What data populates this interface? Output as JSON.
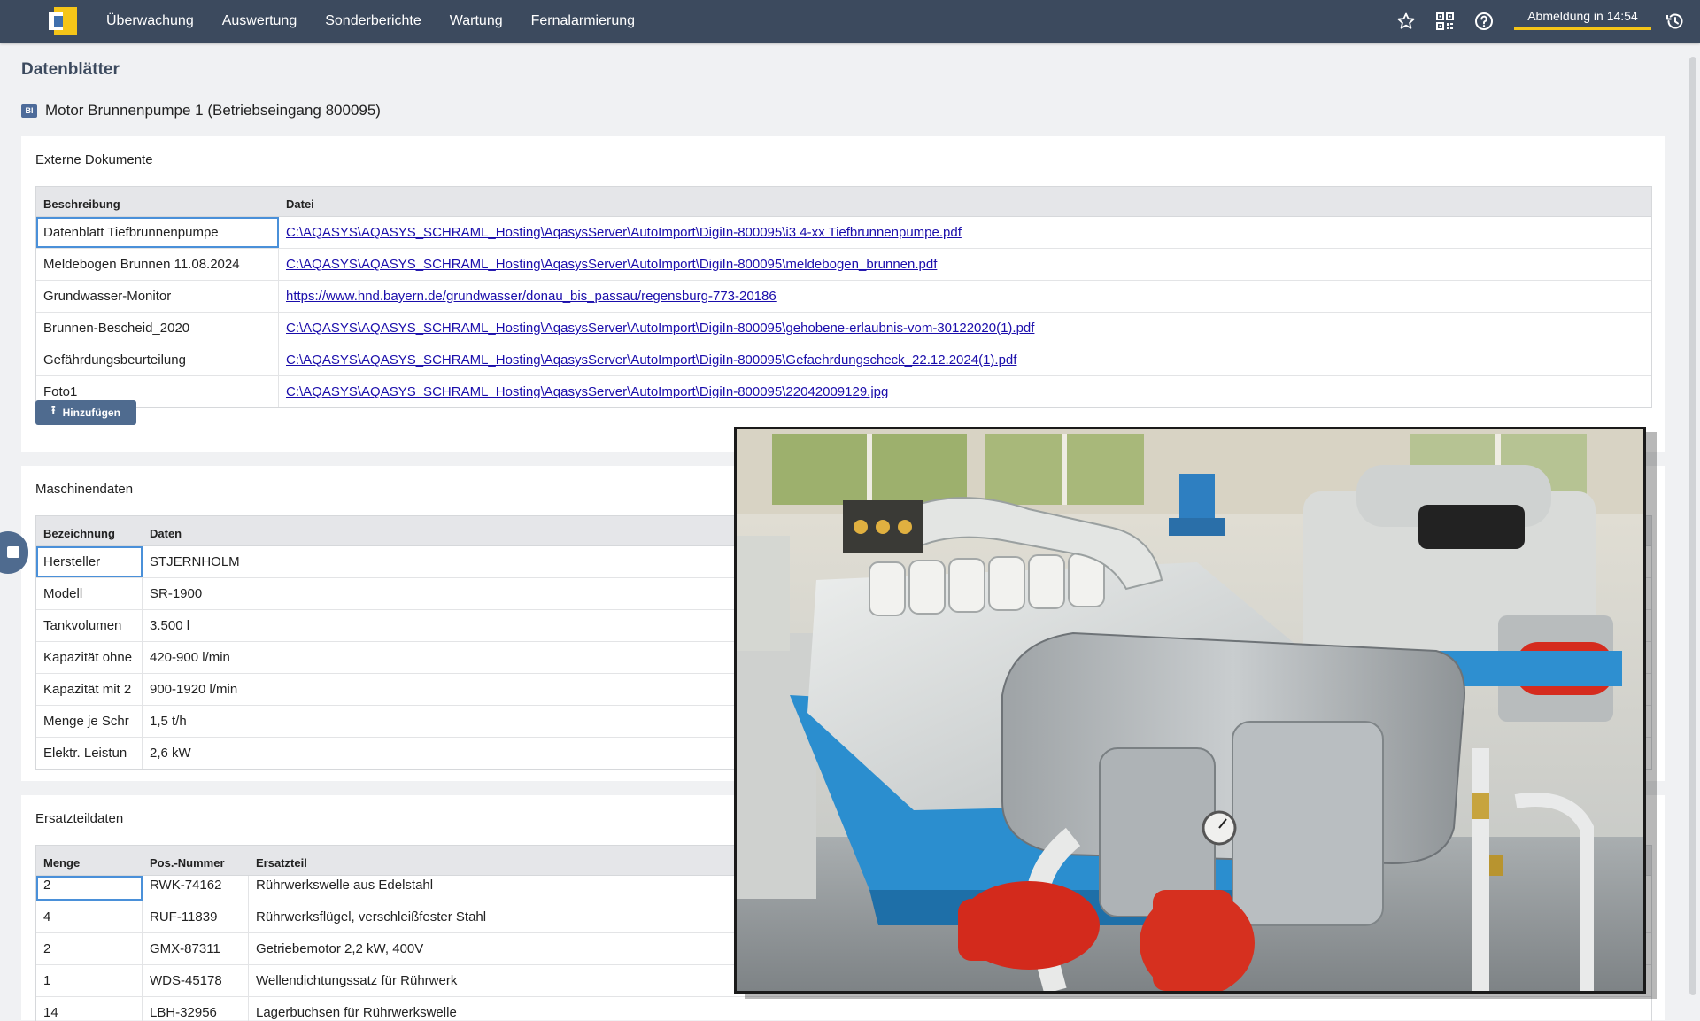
{
  "nav": {
    "menu": [
      "Überwachung",
      "Auswertung",
      "Sonderberichte",
      "Wartung",
      "Fernalarmierung"
    ],
    "logout_label": "Abmeldung in 14:54"
  },
  "page": {
    "title": "Datenblätter",
    "object_badge": "BI",
    "object_title": "Motor Brunnenpumpe 1 (Betriebseingang 800095)"
  },
  "documents": {
    "section_title": "Externe Dokumente",
    "columns": [
      "Beschreibung",
      "Datei"
    ],
    "rows": [
      {
        "desc": "Datenblatt Tiefbrunnenpumpe",
        "file": "C:\\AQASYS\\AQASYS_SCHRAML_Hosting\\AqasysServer\\AutoImport\\DigiIn-800095\\i3 4-xx Tiefbrunnenpumpe.pdf"
      },
      {
        "desc": "Meldebogen Brunnen 11.08.2024",
        "file": "C:\\AQASYS\\AQASYS_SCHRAML_Hosting\\AqasysServer\\AutoImport\\DigiIn-800095\\meldebogen_brunnen.pdf"
      },
      {
        "desc": "Grundwasser-Monitor",
        "file": "https://www.hnd.bayern.de/grundwasser/donau_bis_passau/regensburg-773-20186"
      },
      {
        "desc": "Brunnen-Bescheid_2020",
        "file": "C:\\AQASYS\\AQASYS_SCHRAML_Hosting\\AqasysServer\\AutoImport\\DigiIn-800095\\gehobene-erlaubnis-vom-30122020(1).pdf"
      },
      {
        "desc": "Gefährdungsbeurteilung",
        "file": "C:\\AQASYS\\AQASYS_SCHRAML_Hosting\\AqasysServer\\AutoImport\\DigiIn-800095\\Gefaehrdungscheck_22.12.2024(1).pdf"
      },
      {
        "desc": "Foto1",
        "file": "C:\\AQASYS\\AQASYS_SCHRAML_Hosting\\AqasysServer\\AutoImport\\DigiIn-800095\\22042009129.jpg"
      }
    ],
    "add_button": "Hinzufügen"
  },
  "machine": {
    "section_title": "Maschinendaten",
    "columns": [
      "Bezeichnung",
      "Daten"
    ],
    "rows": [
      {
        "label": "Hersteller",
        "value": "STJERNHOLM"
      },
      {
        "label": "Modell",
        "value": "SR-1900"
      },
      {
        "label": "Tankvolumen",
        "value": "3.500 l"
      },
      {
        "label": "Kapazität ohne",
        "value": "420-900 l/min"
      },
      {
        "label": "Kapazität mit 2",
        "value": "900-1920 l/min"
      },
      {
        "label": "Menge je Schr",
        "value": "1,5 t/h"
      },
      {
        "label": "Elektr. Leistun",
        "value": "2,6 kW"
      }
    ]
  },
  "parts": {
    "section_title": "Ersatzteildaten",
    "columns": [
      "Menge",
      "Pos.-Nummer",
      "Ersatzteil"
    ],
    "rows": [
      {
        "qty": "2",
        "pos": "RWK-74162",
        "part": "Rührwerkswelle aus Edelstahl"
      },
      {
        "qty": "4",
        "pos": "RUF-11839",
        "part": "Rührwerksflügel, verschleißfester Stahl"
      },
      {
        "qty": "2",
        "pos": "GMX-87311",
        "part": "Getriebemotor 2,2 kW, 400V"
      },
      {
        "qty": "1",
        "pos": "WDS-45178",
        "part": "Wellendichtungssatz für Rührwerk"
      },
      {
        "qty": "14",
        "pos": "LBH-32956",
        "part": "Lagerbuchsen für Rührwerkswelle"
      }
    ]
  },
  "icons": {
    "favorite": "star-icon",
    "qr": "qr-code-icon",
    "help": "help-icon",
    "history": "history-icon",
    "upload": "upload-icon",
    "sidetab": "camera-icon"
  },
  "colors": {
    "navbar": "#3c4a5e",
    "accent": "#f5c518",
    "button": "#4f6b8f",
    "link": "#1a0dab"
  }
}
